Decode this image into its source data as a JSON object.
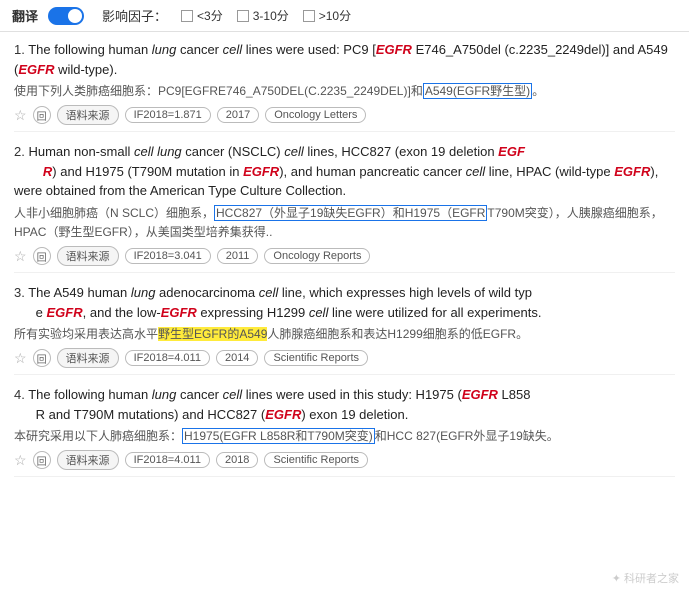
{
  "topbar": {
    "translate_label": "翻译",
    "toggle_on": true,
    "filter_label": "影响因子：",
    "filters": [
      {
        "label": "<3分",
        "checked": false
      },
      {
        "label": "3-10分",
        "checked": false
      },
      {
        "label": ">10分",
        "checked": false
      }
    ]
  },
  "results": [
    {
      "number": "1.",
      "en_parts": [
        {
          "text": "The following human ",
          "style": "normal"
        },
        {
          "text": "lung",
          "style": "italic"
        },
        {
          "text": " cancer ",
          "style": "normal"
        },
        {
          "text": "cell",
          "style": "italic"
        },
        {
          "text": " lines were used: PC9 [",
          "style": "normal"
        },
        {
          "text": "EGFR",
          "style": "bold-italic-red"
        },
        {
          "text": " E746_A750del (c.2235_2249del)] and A549 (",
          "style": "normal"
        },
        {
          "text": "EGFR",
          "style": "bold-italic-red"
        },
        {
          "text": " wild-type).",
          "style": "normal"
        }
      ],
      "cn": "使用下列人类肺癌细胞系：PC9[EGFRE746_A750DEL(C.2235_2249DEL)]和",
      "cn_highlight": "A549(EGFR野生型)。",
      "cn_after": "",
      "meta": {
        "source_tag": "语料来源",
        "if_tag": "IF2018=1.871",
        "year_tag": "2017",
        "journal_tag": "Oncology Letters"
      }
    },
    {
      "number": "2.",
      "en_parts": [
        {
          "text": "Human non-small ",
          "style": "normal"
        },
        {
          "text": "cell lung",
          "style": "italic"
        },
        {
          "text": " cancer (NSCLC) ",
          "style": "normal"
        },
        {
          "text": "cell",
          "style": "italic"
        },
        {
          "text": " lines, HCC827 (exon 19 deletion ",
          "style": "normal"
        },
        {
          "text": "EGF",
          "style": "bold-italic-red"
        },
        {
          "text": "R",
          "style": "bold-italic-red"
        },
        {
          "text": ") and H1975 (T790M mutation in ",
          "style": "normal"
        },
        {
          "text": "EGFR",
          "style": "bold-italic-red"
        },
        {
          "text": "), and human pancreatic cancer ",
          "style": "normal"
        },
        {
          "text": "cell",
          "style": "italic"
        },
        {
          "text": " line, HPAC (wild-type ",
          "style": "normal"
        },
        {
          "text": "EGFR",
          "style": "bold-italic-red"
        },
        {
          "text": "), were obtained from the American Type Culture Collection.",
          "style": "normal"
        }
      ],
      "cn_before": "人非小细胞肺癌（N SCLC）细胞系，",
      "cn_highlight1": "HCC827（外显子19缺失EGFR）和H1975（EGFR",
      "cn_middle": "T790M突变），人胰腺癌细胞系，HPAC（野生型EGFR），从美国类型培养集获得..",
      "meta": {
        "source_tag": "语料来源",
        "if_tag": "IF2018=3.041",
        "year_tag": "2011",
        "journal_tag": "Oncology Reports"
      }
    },
    {
      "number": "3.",
      "en_parts": [
        {
          "text": "The A549 human ",
          "style": "normal"
        },
        {
          "text": "lung",
          "style": "italic"
        },
        {
          "text": " adenocarcinoma ",
          "style": "normal"
        },
        {
          "text": "cell",
          "style": "italic"
        },
        {
          "text": " line, which expresses high levels of wild type ",
          "style": "normal"
        },
        {
          "text": "EGFR",
          "style": "bold-italic-red"
        },
        {
          "text": ", and the low-",
          "style": "normal"
        },
        {
          "text": "EGFR",
          "style": "bold-italic-red"
        },
        {
          "text": " expressing H1299 ",
          "style": "normal"
        },
        {
          "text": "cell",
          "style": "italic"
        },
        {
          "text": " line were utilized for all experiments.",
          "style": "normal"
        }
      ],
      "cn_before": "所有实验均采用表达高水平",
      "cn_highlight": "野生型EGFR的A549",
      "cn_after": "人肺腺癌细胞系和表达H1299细胞系的低EGFR。",
      "meta": {
        "source_tag": "语料来源",
        "if_tag": "IF2018=4.011",
        "year_tag": "2014",
        "journal_tag": "Scientific Reports"
      }
    },
    {
      "number": "4.",
      "en_parts": [
        {
          "text": "The following human ",
          "style": "normal"
        },
        {
          "text": "lung",
          "style": "italic"
        },
        {
          "text": " cancer ",
          "style": "normal"
        },
        {
          "text": "cell",
          "style": "italic"
        },
        {
          "text": " lines were used in this study: H1975 (",
          "style": "normal"
        },
        {
          "text": "EGFR",
          "style": "bold-italic-red"
        },
        {
          "text": " L858R and T790M mutations) and HCC827 (",
          "style": "normal"
        },
        {
          "text": "EGFR",
          "style": "bold-italic-red"
        },
        {
          "text": " exon 19 deletion.",
          "style": "normal"
        }
      ],
      "cn_before": "本研究采用以下人肺癌细胞系：",
      "cn_highlight": "H1975(EGFR L858R和T790M突变)",
      "cn_after": "和HCC 827(EGFR外显子19缺失。",
      "meta": {
        "source_tag": "语料来源",
        "if_tag": "IF2018=4.011",
        "year_tag": "2018",
        "journal_tag": "Scientific Reports"
      }
    }
  ],
  "watermark": "科研者之家"
}
